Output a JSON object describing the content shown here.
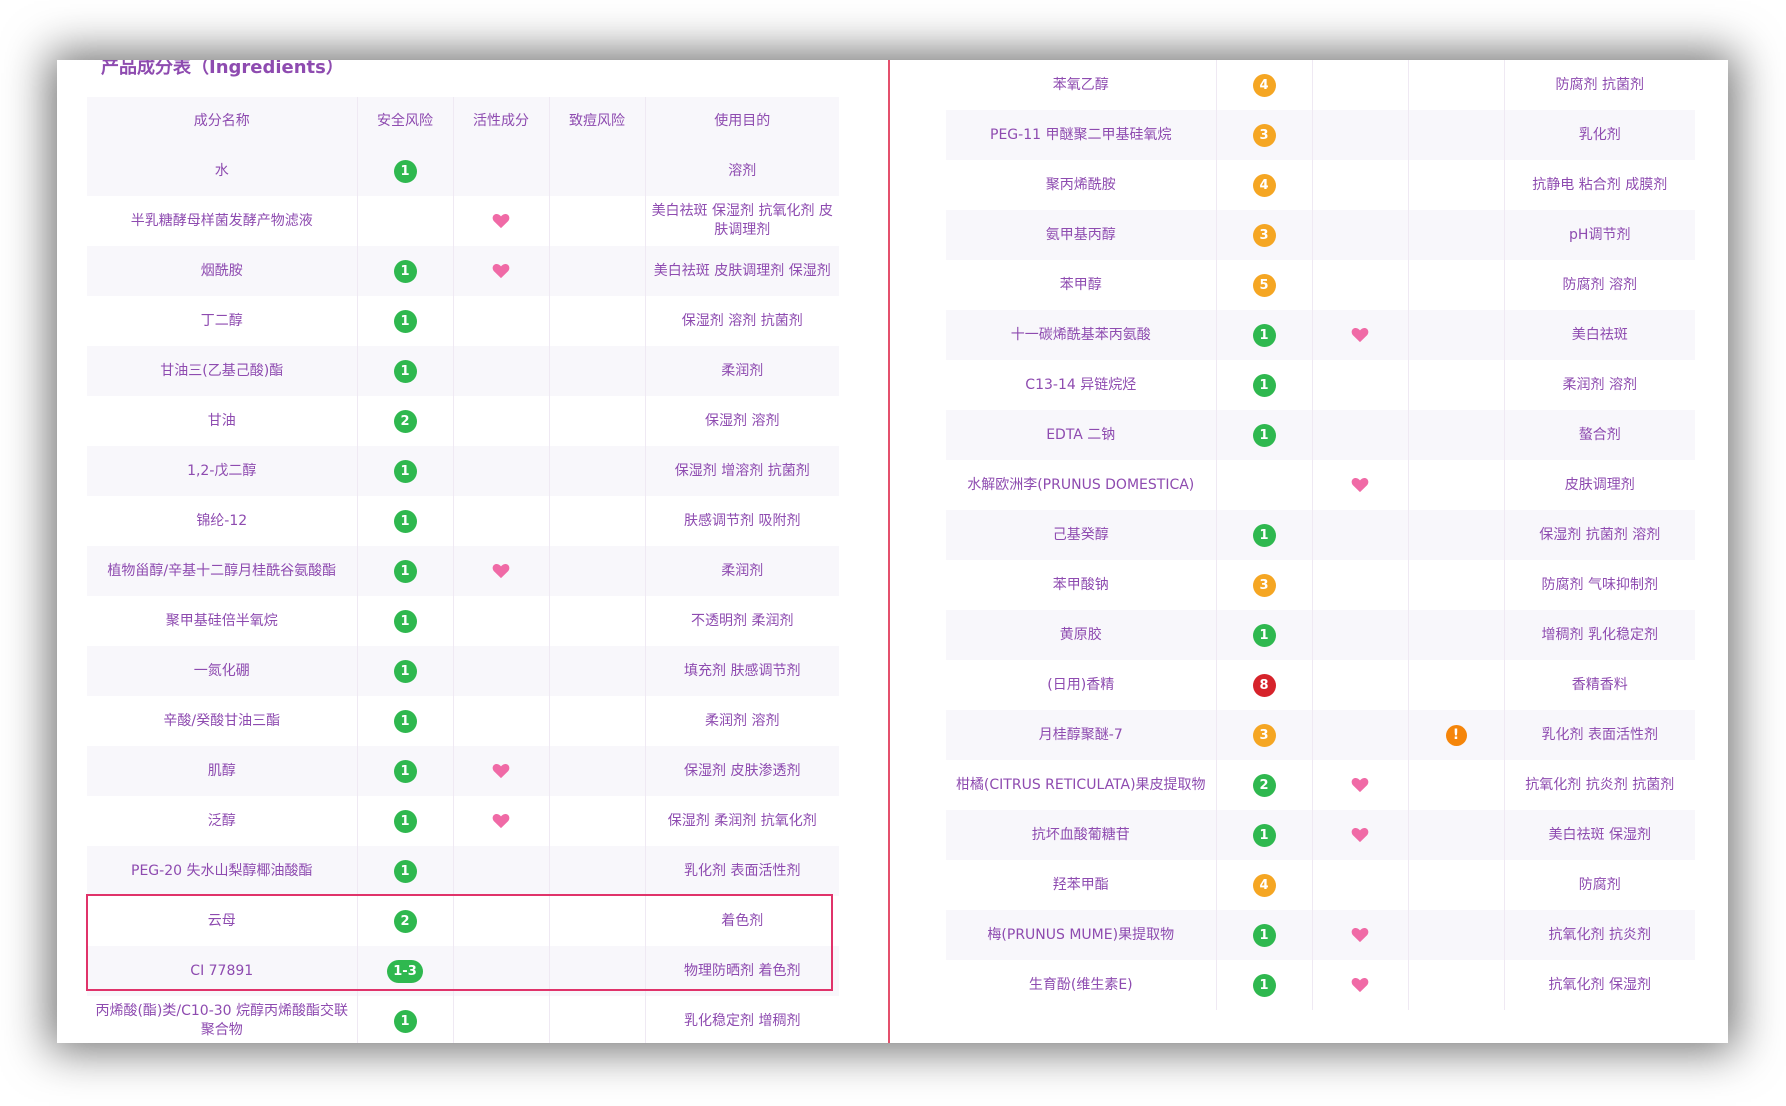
{
  "section_title": "产品成分表（Ingredients）",
  "headers": [
    "成分名称",
    "安全风险",
    "活性成分",
    "致痘风险",
    "使用目的"
  ],
  "colors": {
    "text": "#8e4bb0",
    "risk_low": "#2fb84f",
    "risk_mid": "#f5a623",
    "risk_high": "#d6232b",
    "heart": "#f06aa6",
    "warn": "#f5850a",
    "highlight": "#e0336a"
  },
  "left_rows": [
    {
      "name": "水",
      "risk": "1",
      "level": "low",
      "active": false,
      "acne": false,
      "purpose": "溶剂"
    },
    {
      "name": "半乳糖酵母样菌发酵产物滤液",
      "risk": "",
      "level": "",
      "active": true,
      "acne": false,
      "purpose": "美白祛斑 保湿剂 抗氧化剂 皮肤调理剂"
    },
    {
      "name": "烟酰胺",
      "risk": "1",
      "level": "low",
      "active": true,
      "acne": false,
      "purpose": "美白祛斑 皮肤调理剂 保湿剂"
    },
    {
      "name": "丁二醇",
      "risk": "1",
      "level": "low",
      "active": false,
      "acne": false,
      "purpose": "保湿剂 溶剂 抗菌剂"
    },
    {
      "name": "甘油三(乙基己酸)酯",
      "risk": "1",
      "level": "low",
      "active": false,
      "acne": false,
      "purpose": "柔润剂"
    },
    {
      "name": "甘油",
      "risk": "2",
      "level": "low",
      "active": false,
      "acne": false,
      "purpose": "保湿剂 溶剂"
    },
    {
      "name": "1,2-戊二醇",
      "risk": "1",
      "level": "low",
      "active": false,
      "acne": false,
      "purpose": "保湿剂 增溶剂 抗菌剂"
    },
    {
      "name": "锦纶-12",
      "risk": "1",
      "level": "low",
      "active": false,
      "acne": false,
      "purpose": "肤感调节剂 吸附剂"
    },
    {
      "name": "植物甾醇/辛基十二醇月桂酰谷氨酸酯",
      "risk": "1",
      "level": "low",
      "active": true,
      "acne": false,
      "purpose": "柔润剂"
    },
    {
      "name": "聚甲基硅倍半氧烷",
      "risk": "1",
      "level": "low",
      "active": false,
      "acne": false,
      "purpose": "不透明剂 柔润剂"
    },
    {
      "name": "一氮化硼",
      "risk": "1",
      "level": "low",
      "active": false,
      "acne": false,
      "purpose": "填充剂 肤感调节剂"
    },
    {
      "name": "辛酸/癸酸甘油三酯",
      "risk": "1",
      "level": "low",
      "active": false,
      "acne": false,
      "purpose": "柔润剂 溶剂"
    },
    {
      "name": "肌醇",
      "risk": "1",
      "level": "low",
      "active": true,
      "acne": false,
      "purpose": "保湿剂 皮肤渗透剂"
    },
    {
      "name": "泛醇",
      "risk": "1",
      "level": "low",
      "active": true,
      "acne": false,
      "purpose": "保湿剂 柔润剂 抗氧化剂"
    },
    {
      "name": "PEG-20 失水山梨醇椰油酸酯",
      "risk": "1",
      "level": "low",
      "active": false,
      "acne": false,
      "purpose": "乳化剂 表面活性剂"
    },
    {
      "name": "云母",
      "risk": "2",
      "level": "low",
      "active": false,
      "acne": false,
      "purpose": "着色剂"
    },
    {
      "name": "CI 77891",
      "risk": "1-3",
      "level": "low",
      "active": false,
      "acne": false,
      "purpose": "物理防晒剂 着色剂"
    },
    {
      "name": "丙烯酸(酯)类/C10-30 烷醇丙烯酸酯交联聚合物",
      "risk": "1",
      "level": "low",
      "active": false,
      "acne": false,
      "purpose": "乳化稳定剂 增稠剂"
    }
  ],
  "right_rows": [
    {
      "name": "苯氧乙醇",
      "risk": "4",
      "level": "mid",
      "active": false,
      "acne": false,
      "purpose": "防腐剂 抗菌剂"
    },
    {
      "name": "PEG-11 甲醚聚二甲基硅氧烷",
      "risk": "3",
      "level": "mid",
      "active": false,
      "acne": false,
      "purpose": "乳化剂"
    },
    {
      "name": "聚丙烯酰胺",
      "risk": "4",
      "level": "mid",
      "active": false,
      "acne": false,
      "purpose": "抗静电 粘合剂 成膜剂"
    },
    {
      "name": "氨甲基丙醇",
      "risk": "3",
      "level": "mid",
      "active": false,
      "acne": false,
      "purpose": "pH调节剂"
    },
    {
      "name": "苯甲醇",
      "risk": "5",
      "level": "mid",
      "active": false,
      "acne": false,
      "purpose": "防腐剂 溶剂"
    },
    {
      "name": "十一碳烯酰基苯丙氨酸",
      "risk": "1",
      "level": "low",
      "active": true,
      "acne": false,
      "purpose": "美白祛斑"
    },
    {
      "name": "C13-14 异链烷烃",
      "risk": "1",
      "level": "low",
      "active": false,
      "acne": false,
      "purpose": "柔润剂 溶剂"
    },
    {
      "name": "EDTA 二钠",
      "risk": "1",
      "level": "low",
      "active": false,
      "acne": false,
      "purpose": "螯合剂"
    },
    {
      "name": "水解欧洲李(PRUNUS DOMESTICA)",
      "risk": "",
      "level": "",
      "active": true,
      "acne": false,
      "purpose": "皮肤调理剂"
    },
    {
      "name": "己基癸醇",
      "risk": "1",
      "level": "low",
      "active": false,
      "acne": false,
      "purpose": "保湿剂 抗菌剂 溶剂"
    },
    {
      "name": "苯甲酸钠",
      "risk": "3",
      "level": "mid",
      "active": false,
      "acne": false,
      "purpose": "防腐剂 气味抑制剂"
    },
    {
      "name": "黄原胶",
      "risk": "1",
      "level": "low",
      "active": false,
      "acne": false,
      "purpose": "增稠剂 乳化稳定剂"
    },
    {
      "name": "(日用)香精",
      "risk": "8",
      "level": "high",
      "active": false,
      "acne": false,
      "purpose": "香精香料"
    },
    {
      "name": "月桂醇聚醚-7",
      "risk": "3",
      "level": "mid",
      "active": false,
      "acne": true,
      "purpose": "乳化剂 表面活性剂"
    },
    {
      "name": "柑橘(CITRUS RETICULATA)果皮提取物",
      "risk": "2",
      "level": "low",
      "active": true,
      "acne": false,
      "purpose": "抗氧化剂 抗炎剂 抗菌剂"
    },
    {
      "name": "抗坏血酸葡糖苷",
      "risk": "1",
      "level": "low",
      "active": true,
      "acne": false,
      "purpose": "美白祛斑 保湿剂"
    },
    {
      "name": "羟苯甲酯",
      "risk": "4",
      "level": "mid",
      "active": false,
      "acne": false,
      "purpose": "防腐剂"
    },
    {
      "name": "梅(PRUNUS MUME)果提取物",
      "risk": "1",
      "level": "low",
      "active": true,
      "acne": false,
      "purpose": "抗氧化剂 抗炎剂"
    },
    {
      "name": "生育酚(维生素E)",
      "risk": "1",
      "level": "low",
      "active": true,
      "acne": false,
      "purpose": "抗氧化剂 保湿剂"
    }
  ]
}
